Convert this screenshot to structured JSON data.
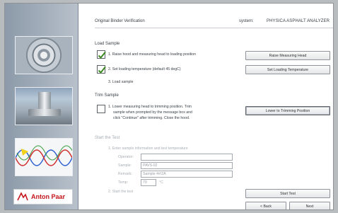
{
  "header": {
    "title": "Original Binder Verification",
    "system_label": "system:",
    "system_value": "PHYSICA ASPHALT ANALYZER"
  },
  "load_sample": {
    "heading": "Load Sample",
    "steps": [
      {
        "text": "1.  Raise hood and measuring head to loading position",
        "checked": true
      },
      {
        "text": "2.  Set loading temperature (default 45 degC)",
        "checked": true
      },
      {
        "text": "3.  Load sample"
      }
    ],
    "buttons": {
      "raise": "Raise Measuring Head",
      "set_temp": "Set Loading Temperature"
    }
  },
  "trim_sample": {
    "heading": "Trim Sample",
    "step_lines": [
      "1.  Lower measuring head to trimming position. Trim",
      "sample when prompted by the message box and",
      "click \"Continue\" after trimming. Close the hood."
    ],
    "button": "Lower to Trimming Position"
  },
  "start_test": {
    "heading": "Start the Test",
    "step1": "1.  Enter sample information and test temperature",
    "fields": {
      "operator_label": "Operator:",
      "operator_value": "",
      "sample_label": "Sample:",
      "sample_value": "PAVS-02",
      "remark_label": "Remark:",
      "remark_value": "Sample 4#/2A",
      "temp_label": "Temp:",
      "temp_value": "70",
      "temp_unit": "°C"
    },
    "step2": "2.  Start the test"
  },
  "footer_buttons": {
    "start": "Start Test",
    "back": "< Back",
    "next": "Next"
  },
  "logo": {
    "text": "Anton Paar"
  },
  "colors": {
    "checkmark": "#3d8a22",
    "brand_red": "#c4161c"
  }
}
